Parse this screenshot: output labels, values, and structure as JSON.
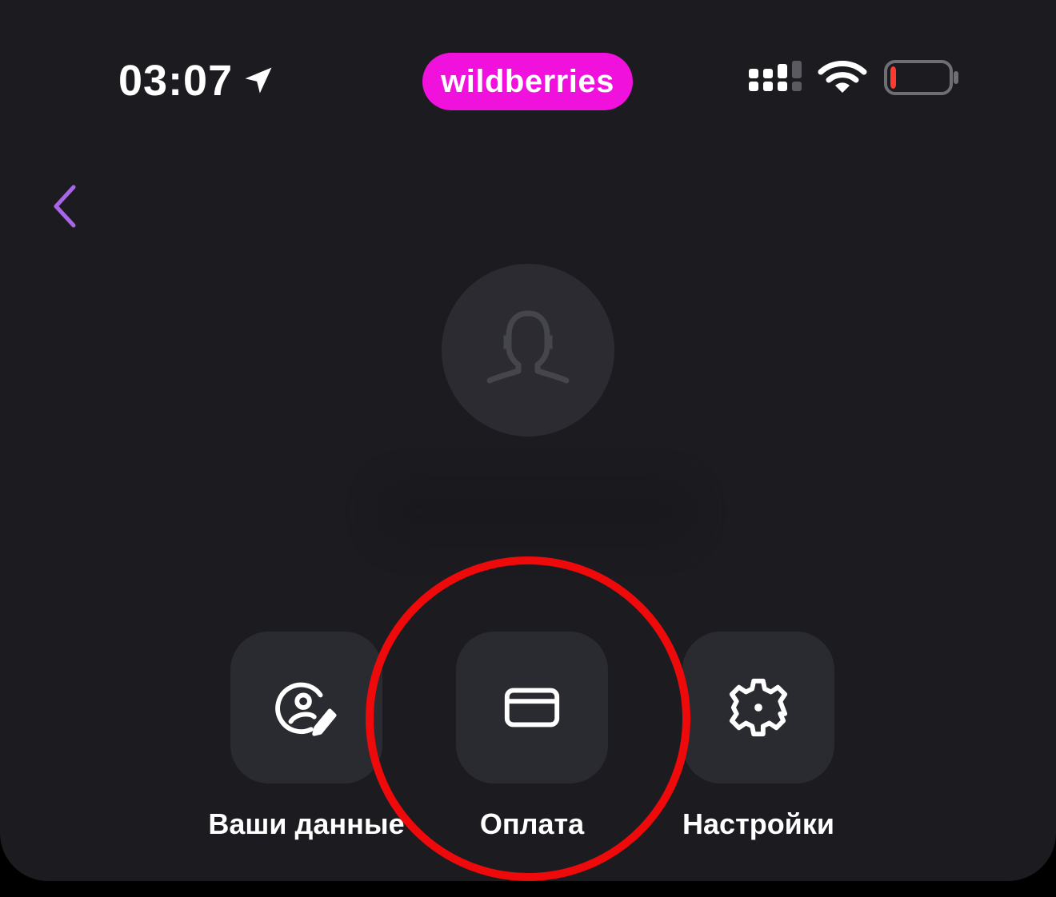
{
  "status_bar": {
    "time": "03:07",
    "brand": "wildberries",
    "icons": {
      "location": "location-arrow-icon",
      "signal": "cellular-signal-icon",
      "wifi": "wifi-icon",
      "battery": "battery-low-icon"
    },
    "battery_level": 0.1
  },
  "navigation": {
    "back_icon": "chevron-left-icon"
  },
  "profile": {
    "avatar_icon": "user-silhouette-icon"
  },
  "actions": [
    {
      "label": "Ваши данные",
      "icon": "user-edit-icon"
    },
    {
      "label": "Оплата",
      "icon": "credit-card-icon"
    },
    {
      "label": "Настройки",
      "icon": "gear-icon"
    }
  ],
  "colors": {
    "background": "#1b1b20",
    "tile": "#2a2a31",
    "brand": "#f012dc",
    "accent": "#a766e8",
    "highlight": "#ee0a0a",
    "battery_low": "#ff3b30"
  }
}
